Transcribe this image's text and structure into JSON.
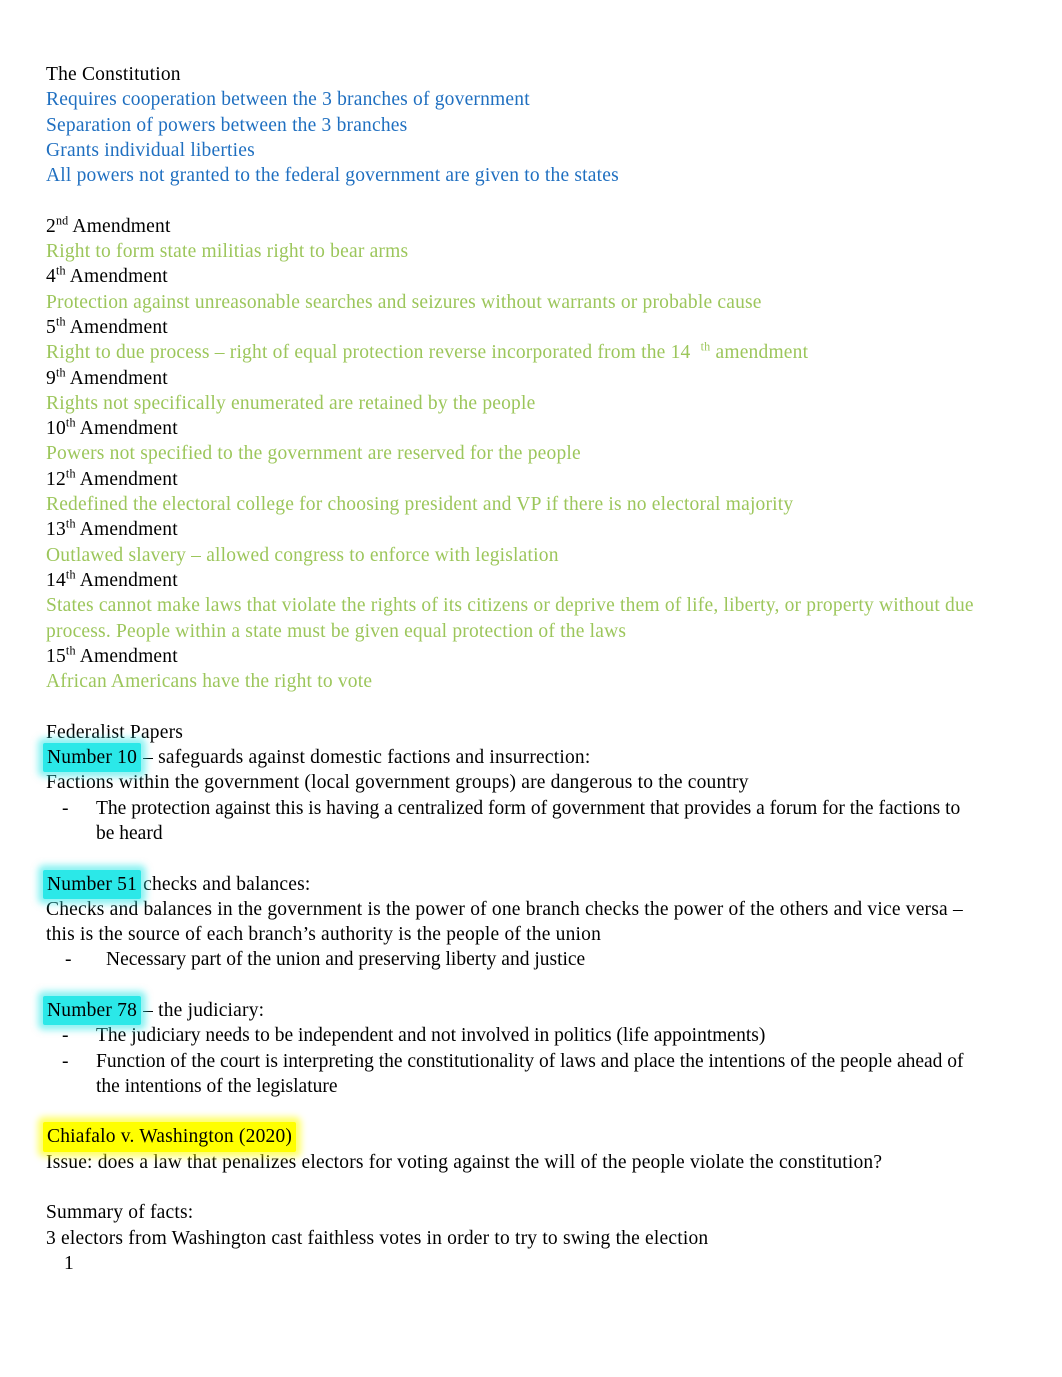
{
  "document": {
    "page_number": "1",
    "colors": {
      "body_text": "#000000",
      "blue_text": "#1F6FC0",
      "green_text": "#9CC65B",
      "cyan_highlight": "#2BE8E8",
      "yellow_highlight": "#FFFF00"
    }
  },
  "constitution": {
    "heading": "The Constitution",
    "points": [
      "Requires cooperation between the 3 branches of government",
      "Separation of powers between the 3 branches",
      "Grants individual liberties",
      "All powers not granted to the federal government are given to the states"
    ]
  },
  "amendments": [
    {
      "number": "2",
      "ordinal": "nd",
      "label": "Amendment",
      "description": "Right to form state militias right to bear arms"
    },
    {
      "number": "4",
      "ordinal": "th",
      "label": "Amendment",
      "description": "Protection against unreasonable searches and seizures without warrants or probable cause"
    },
    {
      "number": "5",
      "ordinal": "th",
      "label": "Amendment",
      "description_part1": "Right to due process – right of equal protection reverse incorporated from the 14",
      "description_sup": "th",
      "description_part2": " amendment"
    },
    {
      "number": "9",
      "ordinal": "th",
      "label": "Amendment",
      "description": "Rights not specifically enumerated are retained by the people"
    },
    {
      "number": "10",
      "ordinal": "th",
      "label": "Amendment",
      "description": "Powers not specified to the government are reserved for the people"
    },
    {
      "number": "12",
      "ordinal": "th",
      "label": "Amendment",
      "description": "Redefined the electoral college for choosing president and VP if there is no electoral majority"
    },
    {
      "number": "13",
      "ordinal": "th",
      "label": "Amendment",
      "description": "Outlawed slavery – allowed congress to enforce with legislation"
    },
    {
      "number": "14",
      "ordinal": "th",
      "label": "Amendment",
      "description": "States cannot make laws that violate the rights of its citizens or deprive them of life, liberty, or property without due process. People within a state must be given equal protection of the laws"
    },
    {
      "number": "15",
      "ordinal": "th",
      "label": "Amendment",
      "description": "African Americans have the right to vote"
    }
  ],
  "federalist": {
    "heading": "Federalist Papers",
    "papers": [
      {
        "highlight": "Number 10",
        "title_rest": " – safeguards against domestic factions and insurrection:",
        "body": "Factions within the government (local government groups) are dangerous to the country",
        "bullets": [
          "The protection against this is having a centralized form of government that provides a forum for the factions to be heard"
        ]
      },
      {
        "highlight": "Number 51",
        "title_rest": " checks and balances:",
        "body": "Checks and balances in the government is the power of one branch checks the power of the others and vice versa – this is the source of each branch’s authority is the people of the union",
        "bullets": [
          "Necessary part of the union and preserving liberty and justice"
        ]
      },
      {
        "highlight": "Number 78",
        "title_rest": " – the judiciary:",
        "body": "",
        "bullets": [
          "The judiciary needs to be independent and not involved in politics (life appointments)",
          "Function of the court is interpreting the constitutionality of laws and place the intentions of the people ahead of the intentions of the legislature"
        ]
      }
    ]
  },
  "case": {
    "title": "Chiafalo v. Washington (2020)",
    "issue": "Issue: does a law that penalizes electors for voting against the will of the people violate the constitution?",
    "summary_heading": "Summary of facts:",
    "summary_body": "3 electors from Washington cast faithless votes in order to try to swing the election"
  },
  "bullet_marker": "-"
}
